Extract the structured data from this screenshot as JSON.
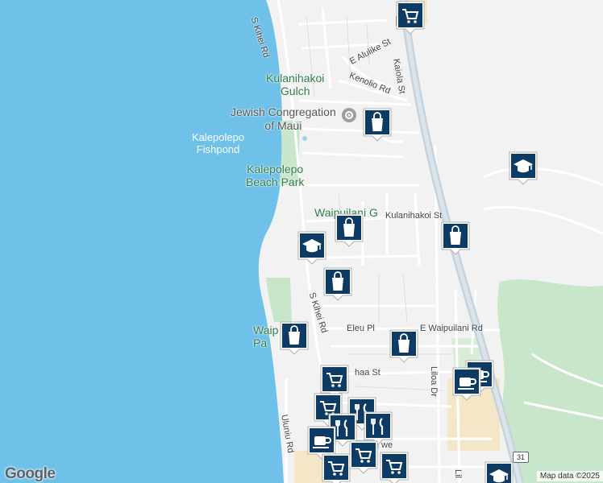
{
  "colors": {
    "ocean": "#6fc1ea",
    "land": "#f2f2f2",
    "green": "#c8e6c9",
    "road": "#ffffff",
    "highway": "#c6d3dc",
    "marker": "#0d3b63"
  },
  "labels": {
    "kulanihakoi_gulch": "Kulanihakoi\nGulch",
    "jewish_congregation": "Jewish Congregation\nof Maui",
    "kalepolepo_fishpond": "Kalepolepo\nFishpond",
    "kalepolepo_beach_park": "Kalepolepo\nBeach Park",
    "waipuilani_gulch": "Waipuilani G",
    "waip_park": "Waip\nPa"
  },
  "roads": {
    "s_kihei_rd_top": "S Kihei Rd",
    "s_kihei_rd_mid": "S Kihei Rd",
    "e_alulike": "E Alulike St",
    "kenolio": "Kenolio Rd",
    "kaiola": "Kaiola St",
    "kulanihakoi_st": "Kulanihakoi St",
    "eleu": "Eleu Pl",
    "e_waipuilani": "E Waipuilani Rd",
    "haa": "haa St",
    "liloa": "Liloa Dr",
    "uluniu": "Uluniu Rd",
    "ave": "we",
    "lil_bottom": "Lil"
  },
  "shields": {
    "top": "31",
    "bottom": "31"
  },
  "markers": [
    {
      "icon": "cart"
    },
    {
      "icon": "bag"
    },
    {
      "icon": "school"
    },
    {
      "icon": "bag"
    },
    {
      "icon": "school"
    },
    {
      "icon": "bag"
    },
    {
      "icon": "bag"
    },
    {
      "icon": "bag"
    },
    {
      "icon": "bag"
    },
    {
      "icon": "cart"
    },
    {
      "icon": "coffee"
    },
    {
      "icon": "coffee"
    },
    {
      "icon": "cart"
    },
    {
      "icon": "dining"
    },
    {
      "icon": "dining"
    },
    {
      "icon": "dining"
    },
    {
      "icon": "coffee"
    },
    {
      "icon": "cart"
    },
    {
      "icon": "cart"
    },
    {
      "icon": "cart"
    },
    {
      "icon": "school"
    }
  ],
  "attribution": {
    "google": "Google",
    "map_data": "Map data ©2025"
  }
}
